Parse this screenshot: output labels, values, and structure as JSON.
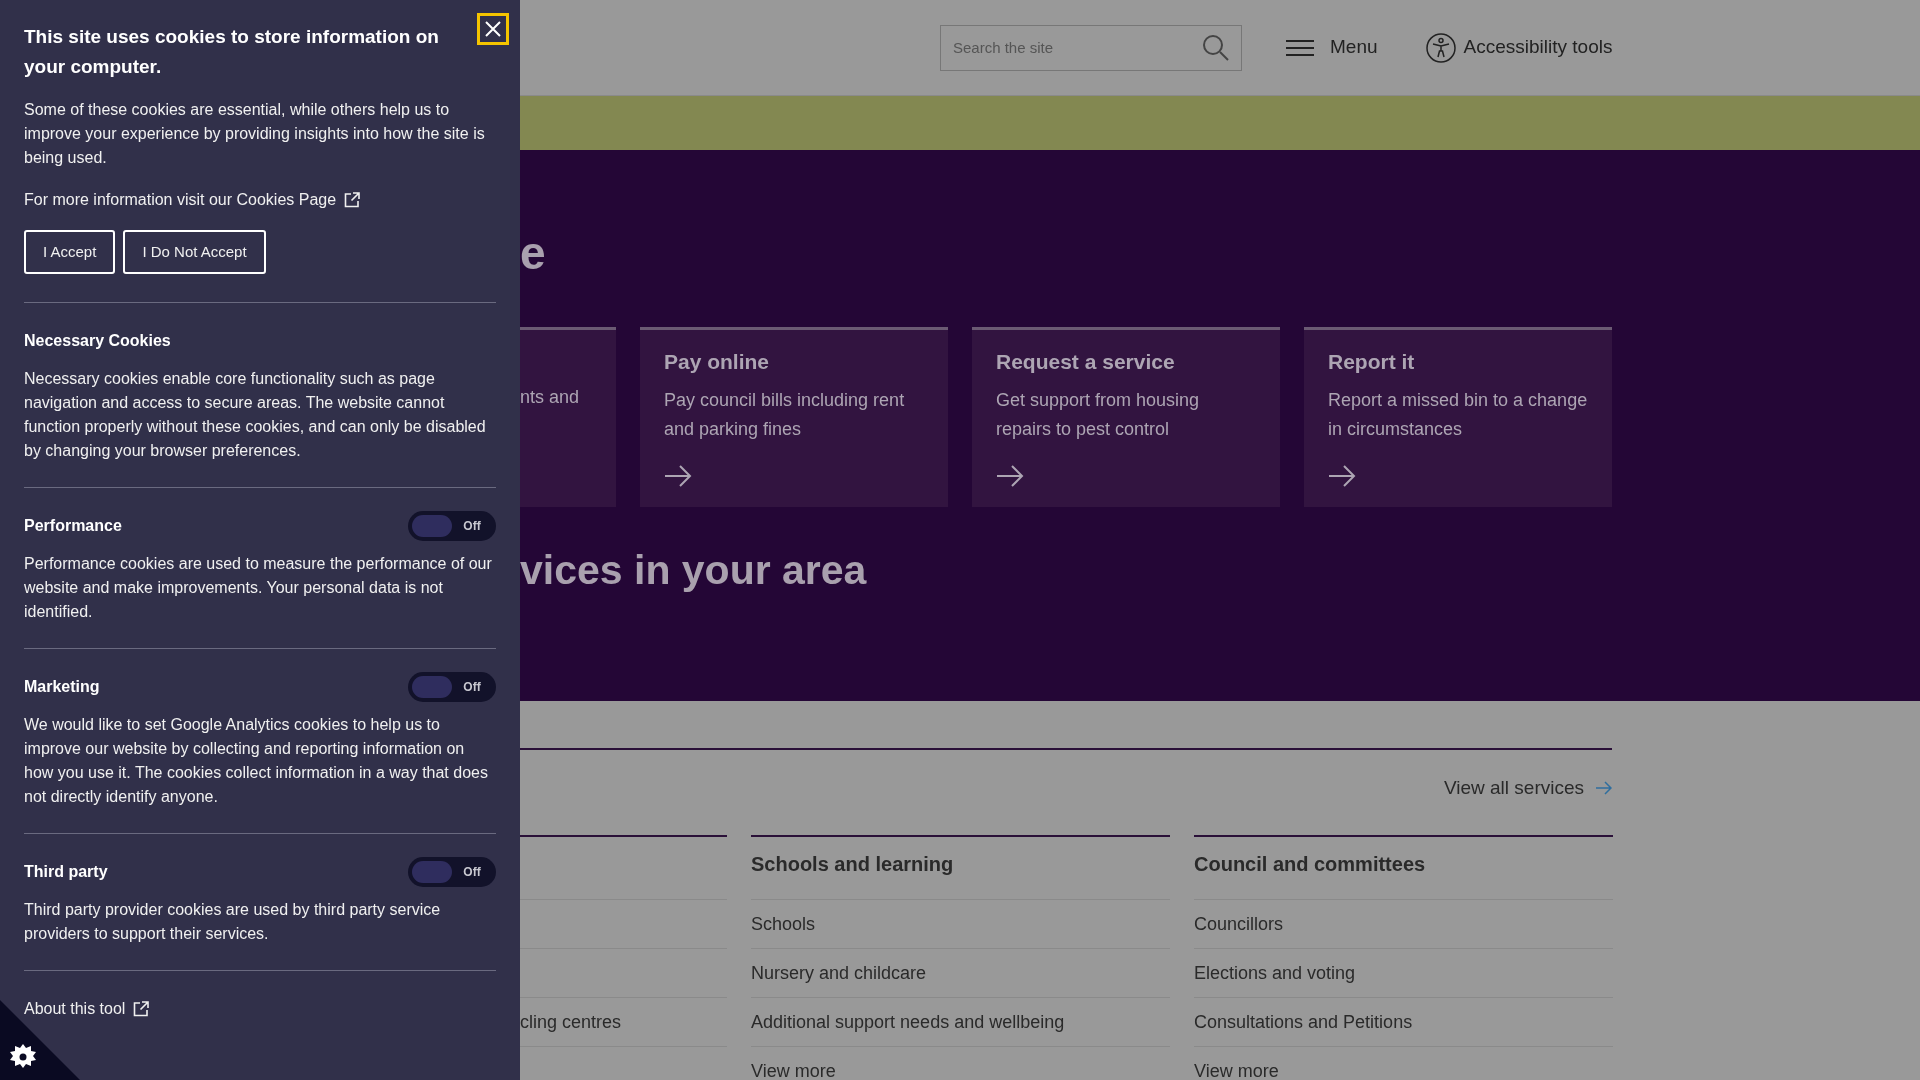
{
  "header": {
    "search": {
      "placeholder": "Search the site"
    },
    "menu_label": "Menu",
    "accessibility_label": "Accessibility tools"
  },
  "hero": {
    "heading_fragment": "e",
    "cards": [
      {
        "description": "nts and"
      },
      {
        "title": "Pay online",
        "description": "Pay council bills including rent and parking fines"
      },
      {
        "title": "Request a service",
        "description": "Get support from housing repairs to pest control"
      },
      {
        "title": "Report it",
        "description": "Report a missed bin to a change in circumstances"
      }
    ],
    "subheading_fragment": "vices in your area"
  },
  "services": {
    "view_all": "View all services",
    "columns": [
      {
        "items": [
          "cling centres"
        ]
      },
      {
        "heading": "Schools and learning",
        "items": [
          "Schools",
          "Nursery and childcare",
          "Additional support needs and wellbeing",
          "View more"
        ]
      },
      {
        "heading": "Council and committees",
        "items": [
          "Councillors",
          "Elections and voting",
          "Consultations and Petitions",
          "View more"
        ]
      }
    ]
  },
  "cookie_panel": {
    "title": "This site uses cookies to store information on your computer.",
    "intro": "Some of these cookies are essential, while others help us to improve your experience by providing insights into how the site is being used.",
    "more_info": "For more information visit our Cookies Page",
    "buttons": [
      "I Accept",
      "I Do Not Accept"
    ],
    "sections": [
      {
        "kind": "fixed",
        "title": "Necessary Cookies",
        "text": "Necessary cookies enable core functionality such as page navigation and access to secure areas. The website cannot function properly without these cookies, and can only be disabled by changing your browser preferences."
      },
      {
        "kind": "toggle",
        "title": "Performance",
        "on": false,
        "state_label": "Off",
        "text": "Performance cookies are used to measure the performance of our website and make improvements. Your personal data is not identified."
      },
      {
        "kind": "toggle",
        "title": "Marketing",
        "on": false,
        "state_label": "Off",
        "text": "We would like to set Google Analytics cookies to help us to improve our website by collecting and reporting information on how you use it. The cookies collect information in a way that does not directly identify anyone."
      },
      {
        "kind": "toggle",
        "title": "Third party",
        "on": false,
        "state_label": "Off",
        "text": "Third party provider cookies are used by third party service providers to support their services."
      }
    ],
    "about_link": "About this tool"
  }
}
